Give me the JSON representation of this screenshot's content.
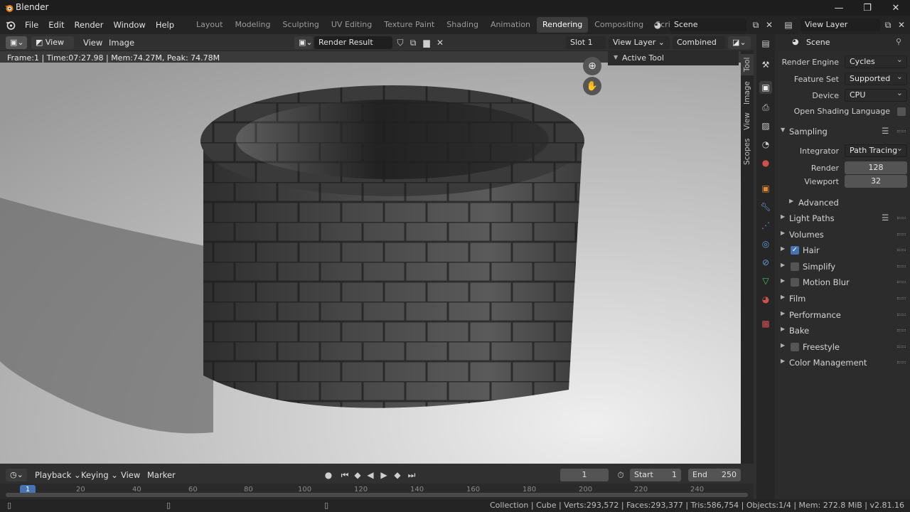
{
  "titlebar": {
    "title": "Blender",
    "minimize": "—",
    "maximize": "❐",
    "close": "✕"
  },
  "menu": [
    "File",
    "Edit",
    "Render",
    "Window",
    "Help"
  ],
  "workspaces": [
    "Layout",
    "Modeling",
    "Sculpting",
    "UV Editing",
    "Texture Paint",
    "Shading",
    "Animation",
    "Rendering",
    "Compositing",
    "Scripting"
  ],
  "active_workspace": "Rendering",
  "scene": {
    "name": "Scene",
    "view_layer": "View Layer"
  },
  "image_header": {
    "view_menu": "View",
    "menus": [
      "View",
      "Image"
    ],
    "image_name": "Render Result",
    "slot": "Slot 1",
    "layer": "View Layer",
    "pass": "Combined"
  },
  "frame_info": "Frame:1 | Time:07:27.98 | Mem:74.27M, Peak: 74.78M",
  "npanel": {
    "title": "Active Tool",
    "tabs": [
      "Tool",
      "Image",
      "View",
      "Scopes"
    ]
  },
  "properties": {
    "header": "Scene",
    "render_engine": {
      "label": "Render Engine",
      "value": "Cycles"
    },
    "feature_set": {
      "label": "Feature Set",
      "value": "Supported"
    },
    "device": {
      "label": "Device",
      "value": "CPU"
    },
    "osl": {
      "label": "Open Shading Language"
    },
    "sampling": {
      "title": "Sampling"
    },
    "integrator": {
      "label": "Integrator",
      "value": "Path Tracing"
    },
    "render_samples": {
      "label": "Render",
      "value": "128"
    },
    "viewport_samples": {
      "label": "Viewport",
      "value": "32"
    },
    "advanced": "Advanced",
    "sections": [
      "Light Paths",
      "Volumes",
      "Hair",
      "Simplify",
      "Motion Blur",
      "Film",
      "Performance",
      "Bake",
      "Freestyle",
      "Color Management"
    ]
  },
  "timeline": {
    "menus": [
      "Playback",
      "Keying",
      "View",
      "Marker"
    ],
    "current_frame": "1",
    "start_label": "Start",
    "start": "1",
    "end_label": "End",
    "end": "250",
    "ticks": [
      "20",
      "40",
      "60",
      "80",
      "100",
      "120",
      "140",
      "160",
      "180",
      "200",
      "220",
      "240"
    ],
    "playhead": "1"
  },
  "statusbar": "Collection | Cube | Verts:293,572 | Faces:293,377 | Tris:586,754 | Objects:1/4 | Mem: 272.8 MiB | v2.81.16",
  "colors": {
    "accent": "#4772b3",
    "active_tab": "#3d3d3d",
    "bg": "#303030"
  }
}
